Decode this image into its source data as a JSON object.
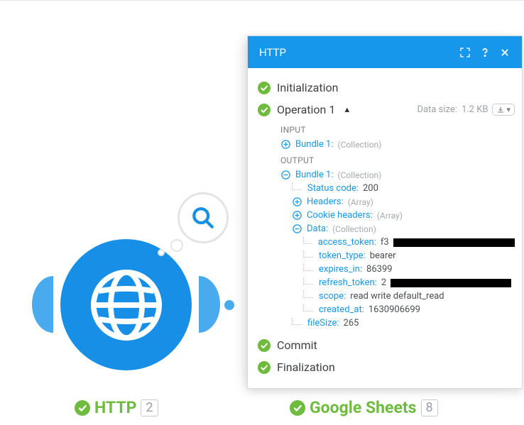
{
  "panel": {
    "title": "HTTP",
    "phases": {
      "init": "Initialization",
      "op": "Operation 1",
      "commit": "Commit",
      "final": "Finalization"
    },
    "dataSizeLabel": "Data size:",
    "dataSize": "1.2 KB",
    "input": {
      "label": "INPUT",
      "bundleLabel": "Bundle 1:",
      "bundleMeta": "(Collection)"
    },
    "output": {
      "label": "OUTPUT",
      "bundleLabel": "Bundle 1:",
      "bundleMeta": "(Collection)",
      "statusKey": "Status code:",
      "statusVal": "200",
      "headersKey": "Headers:",
      "headersMeta": "(Array)",
      "cookieKey": "Cookie headers:",
      "cookieMeta": "(Array)",
      "dataKey": "Data:",
      "dataMeta": "(Collection)",
      "fields": {
        "access_token_k": "access_token:",
        "access_token_v": "f3",
        "token_type_k": "token_type:",
        "token_type_v": "bearer",
        "expires_in_k": "expires_in:",
        "expires_in_v": "86399",
        "refresh_token_k": "refresh_token:",
        "refresh_token_v": "2",
        "scope_k": "scope:",
        "scope_v": "read write default_read",
        "created_at_k": "created_at:",
        "created_at_v": "1630906699"
      },
      "fileSizeKey": "fileSize:",
      "fileSizeVal": "265"
    }
  },
  "modules": {
    "http": {
      "name": "HTTP",
      "count": "2"
    },
    "gsheets": {
      "name": "Google Sheets",
      "count": "8"
    }
  }
}
